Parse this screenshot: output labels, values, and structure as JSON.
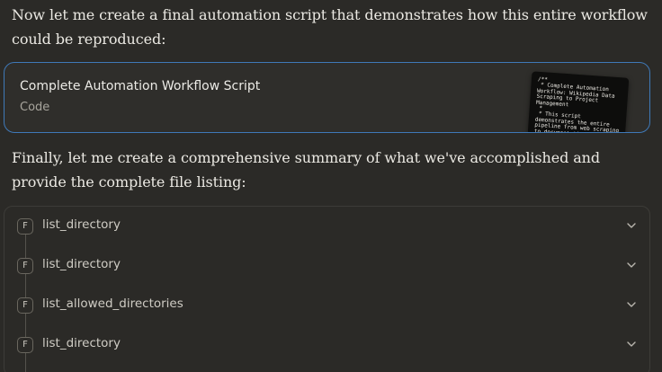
{
  "messages": {
    "para1": "Now let me create a final automation script that demonstrates how this entire workflow could be reproduced:",
    "para2": "Finally, let me create a comprehensive summary of what we've accomplished and provide the complete file listing:"
  },
  "artifact": {
    "title": "Complete Automation Workflow Script",
    "type": "Code",
    "thumbnail_text": "/**\n * Complete Automation Workflow: Wikipedia Data Scraping to Project Management\n *\n * This script demonstrates the entire pipeline from web scraping to documentation\n */"
  },
  "tool_calls": [
    {
      "badge": "F",
      "name": "list_directory"
    },
    {
      "badge": "F",
      "name": "list_directory"
    },
    {
      "badge": "F",
      "name": "list_allowed_directories"
    },
    {
      "badge": "F",
      "name": "list_directory"
    }
  ],
  "colors": {
    "background": "#2b2a27",
    "card_border_active": "#3f79b8",
    "muted_text": "#a7a49c"
  },
  "icons": {
    "tool_row": "chevron-down-icon"
  }
}
